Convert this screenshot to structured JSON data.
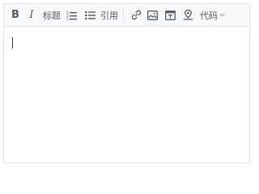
{
  "toolbar": {
    "bold_label": "B",
    "italic_label": "I",
    "heading_label": "标题",
    "quote_label": "引用",
    "code_label": "代码"
  },
  "icons": [
    "bold-icon",
    "italic-icon",
    "ordered-list-icon",
    "unordered-list-icon",
    "link-icon",
    "image-icon",
    "table-icon",
    "location-icon",
    "chevron-down-icon"
  ],
  "colors": {
    "toolbar_bg": "#f7f8f9",
    "border": "#e1e4e8",
    "icon": "#555b62"
  },
  "editor": {
    "content": ""
  }
}
